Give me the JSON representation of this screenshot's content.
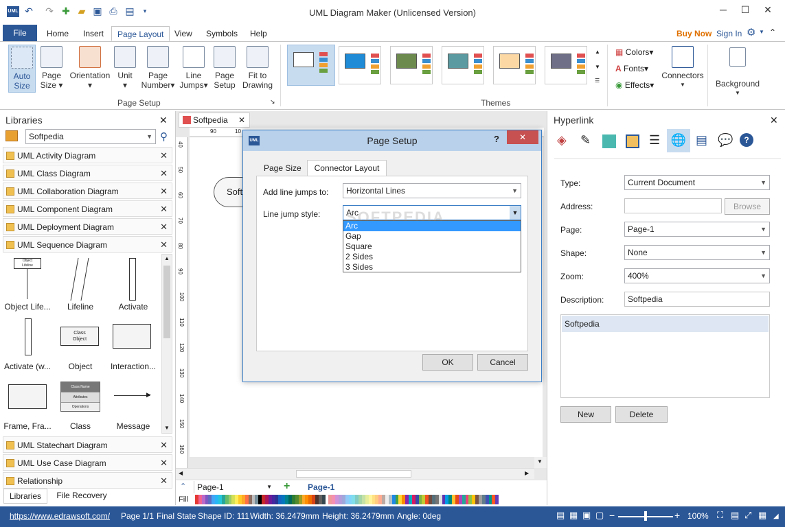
{
  "window": {
    "title": "UML Diagram Maker (Unlicensed Version)",
    "app_logo": "UML"
  },
  "menu": {
    "file": "File",
    "tabs": [
      "Home",
      "Insert",
      "Page Layout",
      "View",
      "Symbols",
      "Help"
    ],
    "active_tab": "Page Layout",
    "buy_now": "Buy Now",
    "sign_in": "Sign In"
  },
  "ribbon": {
    "page_setup": {
      "buttons": [
        {
          "line1": "Auto",
          "line2": "Size"
        },
        {
          "line1": "Page",
          "line2": "Size ▾"
        },
        {
          "line1": "Orientation",
          "line2": "▾"
        },
        {
          "line1": "Unit",
          "line2": "▾"
        },
        {
          "line1": "Page",
          "line2": "Number▾"
        },
        {
          "line1": "Line",
          "line2": "Jumps▾"
        },
        {
          "line1": "Page",
          "line2": "Setup"
        },
        {
          "line1": "Fit to",
          "line2": "Drawing"
        }
      ],
      "label": "Page Setup"
    },
    "themes_label": "Themes",
    "colors": "Colors▾",
    "fonts": "Fonts▾",
    "effects": "Effects▾",
    "connectors": "Connectors",
    "background": "Background",
    "theme_colors": [
      "#ffffff",
      "#1f8bd6",
      "#6d8a4e",
      "#5b9aa0",
      "#fbd8a4",
      "#6f6f88"
    ]
  },
  "libraries": {
    "title": "Libraries",
    "search_value": "Softpedia",
    "items_top": [
      "UML Activity Diagram",
      "UML Class Diagram",
      "UML Collaboration Diagram",
      "UML Component Diagram",
      "UML Deployment Diagram",
      "UML Sequence Diagram"
    ],
    "shapes": [
      "Object Life...",
      "Lifeline",
      "Activate",
      "Activate (w...",
      "Object",
      "Interaction...",
      "Frame, Fra...",
      "Class",
      "Message"
    ],
    "shape_inner": {
      "object_lifeline": "Object\nLifeline",
      "class_object": "Class\nObject",
      "class_name": "Class Name",
      "attributes": "Attributes",
      "operations": "Operations"
    },
    "items_bottom": [
      "UML Statechart Diagram",
      "UML Use Case Diagram",
      "Relationship"
    ],
    "bottom_tabs": [
      "Libraries",
      "File Recovery"
    ]
  },
  "canvas": {
    "doc_tab": "Softpedia",
    "ruler_top": [
      "90",
      "10"
    ],
    "ruler_left": [
      "40",
      "50",
      "60",
      "70",
      "80",
      "90",
      "100",
      "110",
      "120",
      "130",
      "140",
      "150",
      "160"
    ],
    "shape_text": "Soft",
    "page_tab": "Page-1",
    "page_tab_active": "Page-1",
    "fill_label": "Fill"
  },
  "dialog": {
    "title": "Page Setup",
    "help": "?",
    "tabs": [
      "Page Size",
      "Connector Layout"
    ],
    "active_tab": "Connector Layout",
    "add_line_jumps_label": "Add line jumps to:",
    "add_line_jumps_value": "Horizontal Lines",
    "line_jump_style_label": "Line jump style:",
    "line_jump_style_value": "Arc",
    "dropdown_options": [
      "Arc",
      "Gap",
      "Square",
      "2 Sides",
      "3 Sides"
    ],
    "ok": "OK",
    "cancel": "Cancel",
    "watermark": "SOFTPEDIA"
  },
  "hyperlink": {
    "title": "Hyperlink",
    "type_label": "Type:",
    "type_value": "Current Document",
    "address_label": "Address:",
    "address_value": "",
    "browse": "Browse",
    "page_label": "Page:",
    "page_value": "Page-1",
    "shape_label": "Shape:",
    "shape_value": "None",
    "zoom_label": "Zoom:",
    "zoom_value": "400%",
    "description_label": "Description:",
    "description_value": "Softpedia",
    "list_items": [
      "Softpedia"
    ],
    "new": "New",
    "delete": "Delete"
  },
  "status": {
    "url": "https://www.edrawsoft.com/",
    "page": "Page 1/1",
    "state": "Final State",
    "shape_id": "Shape ID: 111",
    "width": "Width: 36.2479mm",
    "height": "Height: 36.2479mm",
    "angle": "Angle: 0deg",
    "zoom": "100%",
    "zoom_fraction": 0.5
  },
  "palette": [
    "#e53935",
    "#f06292",
    "#ba68c8",
    "#7e57c2",
    "#5c6bc0",
    "#42a5f5",
    "#29b6f6",
    "#26c6da",
    "#26a69a",
    "#66bb6a",
    "#9ccc65",
    "#d4e157",
    "#ffee58",
    "#ffca28",
    "#ffa726",
    "#ff7043",
    "#8d6e63",
    "#bdbdbd",
    "#78909c",
    "#000000",
    "#c62828",
    "#ad1457",
    "#6a1b9a",
    "#4527a0",
    "#283593",
    "#1565c0",
    "#0277bd",
    "#00838f",
    "#00695c",
    "#2e7d32",
    "#558b2f",
    "#9e9d24",
    "#f9a825",
    "#ff8f00",
    "#ef6c00",
    "#d84315",
    "#4e342e",
    "#616161",
    "#37474f",
    "#ffffff",
    "#ef9a9a",
    "#f48fb1",
    "#ce93d8",
    "#b39ddb",
    "#9fa8da",
    "#90caf9",
    "#81d4fa",
    "#80deea",
    "#80cbc4",
    "#a5d6a7",
    "#c5e1a5",
    "#e6ee9c",
    "#fff59d",
    "#ffe082",
    "#ffcc80",
    "#ffab91",
    "#bcaaa4",
    "#eeeeee",
    "#b0bec5",
    "#1e88e5",
    "#43a047",
    "#fdd835",
    "#fb8c00",
    "#8e24aa",
    "#00acc1",
    "#d81b60",
    "#3949ab",
    "#7cb342",
    "#c0ca33",
    "#f4511e",
    "#6d4c41",
    "#546e7a",
    "#757575",
    "#e0e0e0",
    "#5e35b1",
    "#039be5",
    "#00897b",
    "#fbc02d",
    "#e64a19",
    "#ab47bc",
    "#26a69a",
    "#ec407a",
    "#8bc34a",
    "#ffc107",
    "#795548",
    "#9e9e9e",
    "#607d8b",
    "#3f51b5",
    "#009688",
    "#ff5722",
    "#673ab7"
  ]
}
